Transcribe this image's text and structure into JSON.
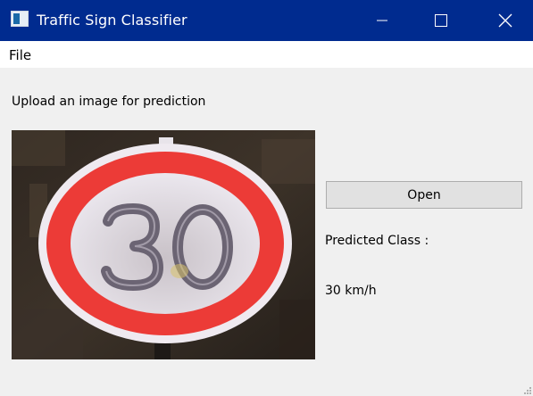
{
  "window": {
    "title": "Traffic Sign Classifier",
    "icon": "app-window-icon",
    "controls": [
      "minimize-icon",
      "maximize-icon",
      "close-icon"
    ],
    "titlebar_color": "#002b8f"
  },
  "menubar": {
    "items": [
      {
        "label": "File"
      }
    ]
  },
  "main": {
    "upload_label": "Upload an image for prediction",
    "image_subject": "speed-limit-30-sign",
    "open_button_label": "Open",
    "predicted_class_label": "Predicted Class :",
    "predicted_class_value": "30 km/h"
  }
}
